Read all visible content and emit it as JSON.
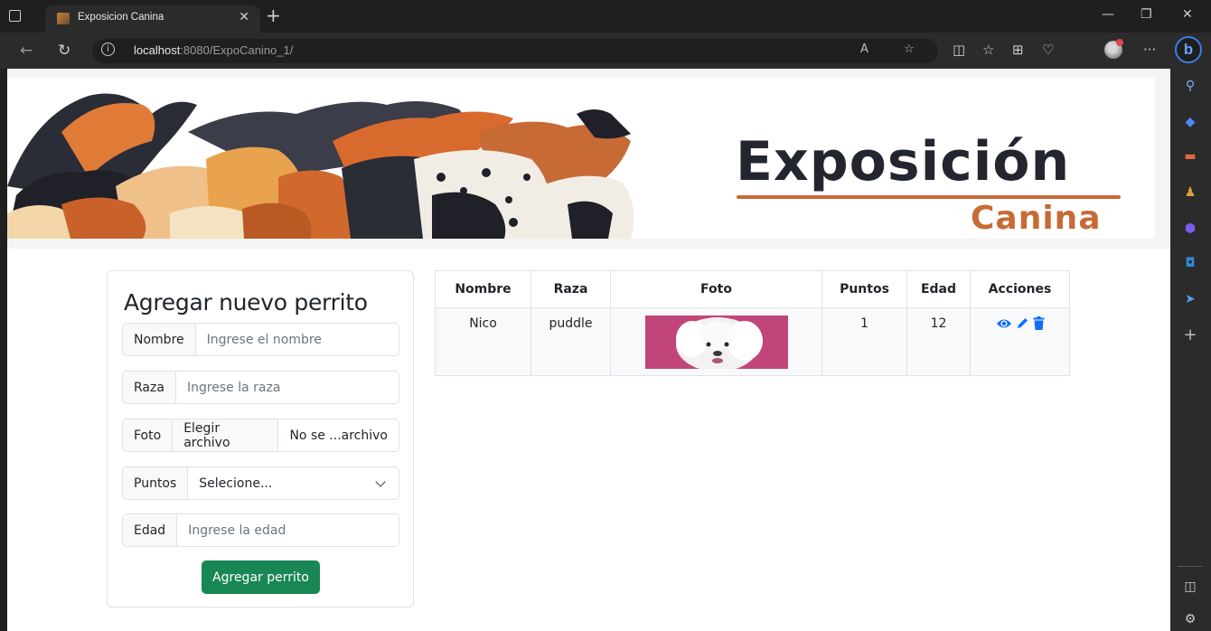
{
  "browser": {
    "tab_title": "Exposicion Canina",
    "url_host": "localhost",
    "url_rest": ":8080/ExpoCanino_1/"
  },
  "banner": {
    "title": "Exposición",
    "subtitle": "Canina"
  },
  "form": {
    "title": "Agregar nuevo perrito",
    "nombre": {
      "label": "Nombre",
      "placeholder": "Ingrese el nombre"
    },
    "raza": {
      "label": "Raza",
      "placeholder": "Ingrese la raza"
    },
    "foto": {
      "label": "Foto",
      "button": "Elegir archivo",
      "status": "No se ...archivo"
    },
    "puntos": {
      "label": "Puntos",
      "selected": "Selecione..."
    },
    "edad": {
      "label": "Edad",
      "placeholder": "Ingrese la edad"
    },
    "submit": "Agregar perrito"
  },
  "table": {
    "headers": [
      "Nombre",
      "Raza",
      "Foto",
      "Puntos",
      "Edad",
      "Acciones"
    ],
    "rows": [
      {
        "nombre": "Nico",
        "raza": "puddle",
        "puntos": "1",
        "edad": "12"
      }
    ]
  },
  "icons": {
    "view": "eye-icon",
    "edit": "pencil-icon",
    "delete": "trash-icon"
  },
  "colors": {
    "accent_green": "#198754",
    "link_blue": "#0d6efd",
    "banner_orange": "#c86a35",
    "banner_dark": "#24262f"
  }
}
